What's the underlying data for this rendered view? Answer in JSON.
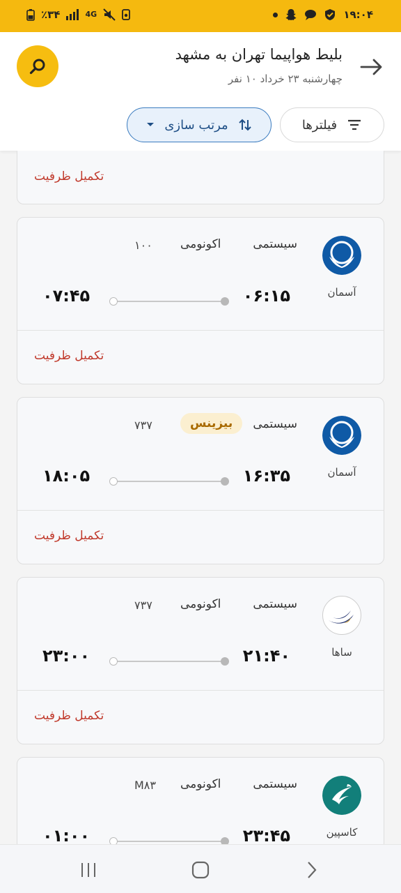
{
  "status_bar": {
    "time": "۱۹:۰۴",
    "battery": "٪۳۴",
    "network": "4G"
  },
  "header": {
    "title": "بلیط هواپیما تهران به مشهد",
    "subtitle": "چهارشنبه ۲۳ خرداد  ۱۰ نفر",
    "filters_label": "فیلترها",
    "sort_label": "مرتب سازی"
  },
  "partial_card": {
    "capacity": "تکمیل ظرفیت"
  },
  "flights": [
    {
      "airline": "آسمان",
      "flight_type": "سیستمی",
      "class": "اکونومی",
      "class_highlight": false,
      "aircraft": "۱۰۰",
      "departure": "۰۶:۱۵",
      "arrival": "۰۷:۴۵",
      "capacity": "تکمیل ظرفیت",
      "logo": "aseman-logo-icon"
    },
    {
      "airline": "آسمان",
      "flight_type": "سیستمی",
      "class": "بیزینس",
      "class_highlight": true,
      "aircraft": "۷۳۷",
      "departure": "۱۶:۳۵",
      "arrival": "۱۸:۰۵",
      "capacity": "تکمیل ظرفیت",
      "logo": "aseman-logo-icon"
    },
    {
      "airline": "ساها",
      "flight_type": "سیستمی",
      "class": "اکونومی",
      "class_highlight": false,
      "aircraft": "۷۳۷",
      "departure": "۲۱:۴۰",
      "arrival": "۲۳:۰۰",
      "capacity": "تکمیل ظرفیت",
      "logo": "saha-logo-icon"
    },
    {
      "airline": "کاسپین",
      "flight_type": "سیستمی",
      "class": "اکونومی",
      "class_highlight": false,
      "aircraft": "M۸۳",
      "departure": "۲۳:۴۵",
      "arrival": "۰۱:۰۰",
      "capacity": "",
      "logo": "caspian-logo-icon"
    }
  ],
  "colors": {
    "brand_yellow": "#f6bd10",
    "capacity_red": "#c0392b",
    "sort_blue": "#3a7bbf"
  }
}
